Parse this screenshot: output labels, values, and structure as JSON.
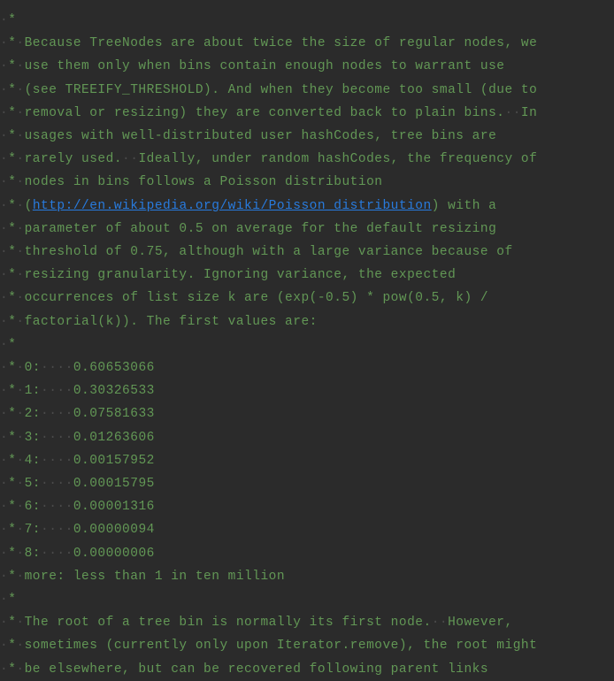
{
  "code": {
    "lines": [
      {
        "prefix": "·*",
        "text": ""
      },
      {
        "prefix": "·*·",
        "text": "Because TreeNodes are about twice the size of regular nodes, we"
      },
      {
        "prefix": "·*·",
        "text": "use them only when bins contain enough nodes to warrant use"
      },
      {
        "prefix": "·*·",
        "text": "(see TREEIFY_THRESHOLD). And when they become too small (due to"
      },
      {
        "prefix": "·*·",
        "text": "removal or resizing) they are converted back to plain bins.  In"
      },
      {
        "prefix": "·*·",
        "text": "usages with well-distributed user hashCodes, tree bins are"
      },
      {
        "prefix": "·*·",
        "text": "rarely used.  Ideally, under random hashCodes, the frequency of"
      },
      {
        "prefix": "·*·",
        "text": "nodes in bins follows a Poisson distribution"
      },
      {
        "prefix": "·*·",
        "text": "(",
        "link": "http://en.wikipedia.org/wiki/Poisson_distribution",
        "text_after": ") with a"
      },
      {
        "prefix": "·*·",
        "text": "parameter of about 0.5 on average for the default resizing"
      },
      {
        "prefix": "·*·",
        "text": "threshold of 0.75, although with a large variance because of"
      },
      {
        "prefix": "·*·",
        "text": "resizing granularity. Ignoring variance, the expected"
      },
      {
        "prefix": "·*·",
        "text": "occurrences of list size k are (exp(-0.5) * pow(0.5, k) /"
      },
      {
        "prefix": "·*·",
        "text": "factorial(k)). The first values are:"
      },
      {
        "prefix": "·*",
        "text": ""
      },
      {
        "prefix": "·*·",
        "text": "0:    0.60653066"
      },
      {
        "prefix": "·*·",
        "text": "1:    0.30326533"
      },
      {
        "prefix": "·*·",
        "text": "2:    0.07581633"
      },
      {
        "prefix": "·*·",
        "text": "3:    0.01263606"
      },
      {
        "prefix": "·*·",
        "text": "4:    0.00157952"
      },
      {
        "prefix": "·*·",
        "text": "5:    0.00015795"
      },
      {
        "prefix": "·*·",
        "text": "6:    0.00001316"
      },
      {
        "prefix": "·*·",
        "text": "7:    0.00000094"
      },
      {
        "prefix": "·*·",
        "text": "8:    0.00000006"
      },
      {
        "prefix": "·*·",
        "text": "more: less than 1 in ten million"
      },
      {
        "prefix": "·*",
        "text": ""
      },
      {
        "prefix": "·*·",
        "text": "The root of a tree bin is normally its first node.  However,"
      },
      {
        "prefix": "·*·",
        "text": "sometimes (currently only upon Iterator.remove), the root might"
      },
      {
        "prefix": "·*·",
        "text": "be elsewhere, but can be recovered following parent links"
      }
    ]
  }
}
